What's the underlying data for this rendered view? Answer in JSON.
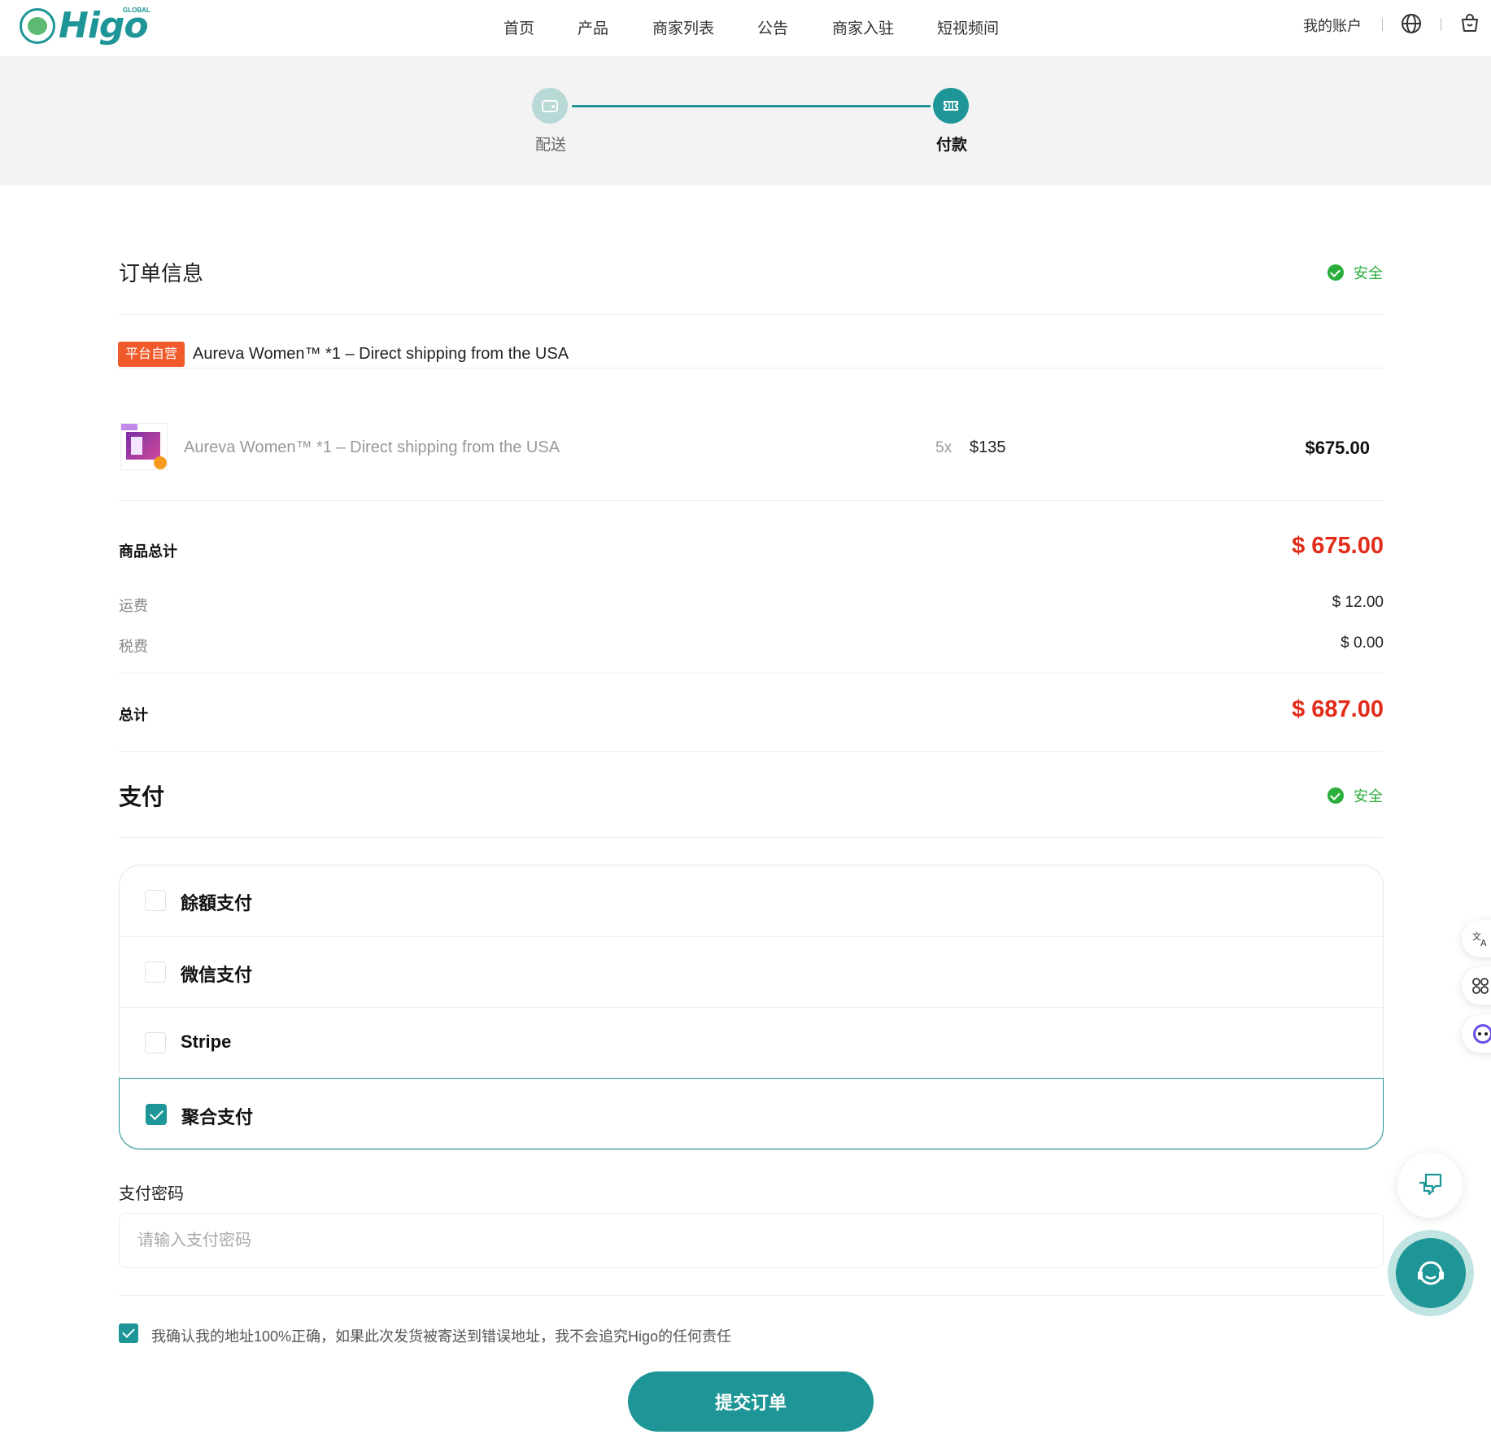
{
  "header": {
    "logo_text": "Higo",
    "logo_sub": "GLOBAL",
    "nav": [
      "首页",
      "产品",
      "商家列表",
      "公告",
      "商家入驻",
      "短视频间"
    ],
    "account": "我的账户"
  },
  "stepper": {
    "steps": [
      "配送",
      "付款"
    ],
    "active": "付款"
  },
  "order": {
    "title": "订单信息",
    "secure_label": "安全",
    "store_badge": "平台自营",
    "store_name": "Aureva Women™ *1 – Direct shipping from the USA",
    "item": {
      "name": "Aureva Women™ *1 – Direct shipping from the USA",
      "qty": "5x",
      "unit_price": "$135",
      "total": "$675.00"
    },
    "subtotal_label": "商品总计",
    "subtotal": "$ 675.00",
    "shipping_label": "运费",
    "shipping": "$ 12.00",
    "tax_label": "税费",
    "tax": "$ 0.00",
    "total_label": "总计",
    "total": "$ 687.00"
  },
  "payment": {
    "title": "支付",
    "secure_label": "安全",
    "methods": [
      {
        "label": "餘額支付",
        "selected": false
      },
      {
        "label": "微信支付",
        "selected": false
      },
      {
        "label": "Stripe",
        "selected": false
      },
      {
        "label": "聚合支付",
        "selected": true
      }
    ],
    "password_label": "支付密码",
    "password_placeholder": "请输入支付密码",
    "confirm_text": "我确认我的地址100%正确，如果此次发货被寄送到错误地址，我不会追究Higo的任何责任",
    "confirm_checked": true,
    "submit_label": "提交订单"
  },
  "colors": {
    "brand": "#1e9596",
    "price_red": "#e32b1a",
    "secure_green": "#2aae3c",
    "badge_orange": "#f0592a"
  }
}
